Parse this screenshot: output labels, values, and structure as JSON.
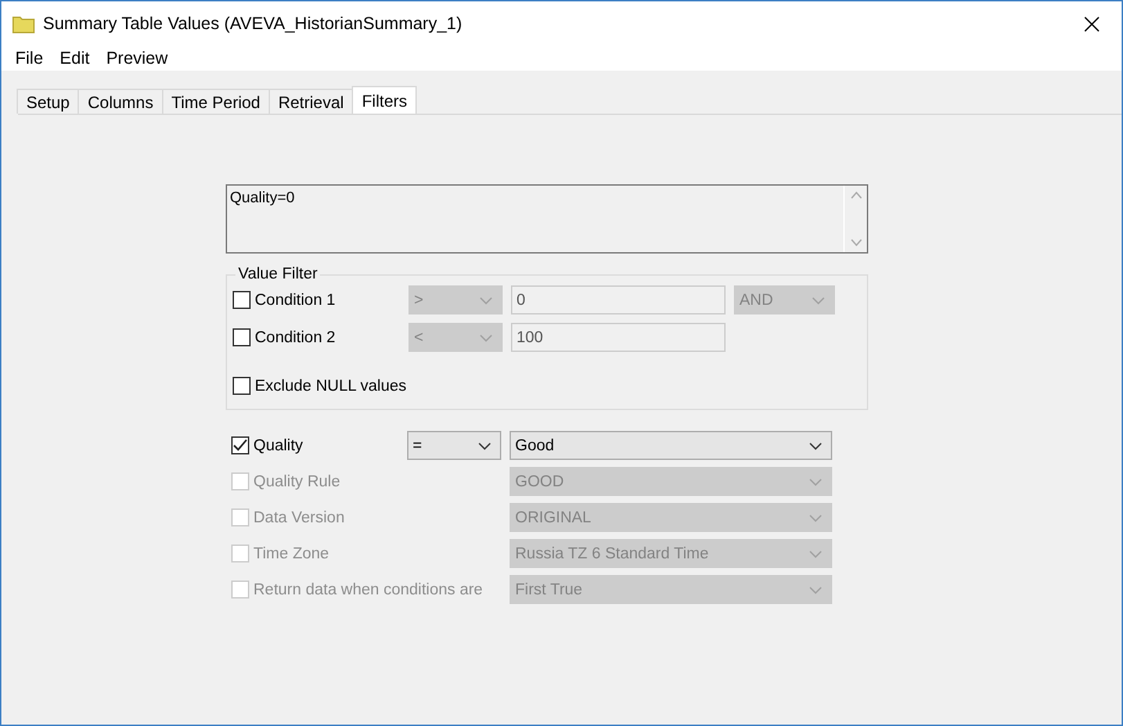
{
  "window": {
    "title": "Summary Table Values (AVEVA_HistorianSummary_1)"
  },
  "menu": [
    "File",
    "Edit",
    "Preview"
  ],
  "tabs": [
    {
      "label": "Setup",
      "selected": false
    },
    {
      "label": "Columns",
      "selected": false
    },
    {
      "label": "Time Period",
      "selected": false
    },
    {
      "label": "Retrieval",
      "selected": false
    },
    {
      "label": "Filters",
      "selected": true
    }
  ],
  "expression": "Quality=0",
  "value_filter": {
    "title": "Value Filter",
    "conditions": [
      {
        "label": "Condition 1",
        "checked": false,
        "operator": ">",
        "value": "0",
        "conjunction": "AND"
      },
      {
        "label": "Condition 2",
        "checked": false,
        "operator": "<",
        "value": "100"
      }
    ],
    "exclude_null": {
      "label": "Exclude NULL values",
      "checked": false
    }
  },
  "options": [
    {
      "label": "Quality",
      "checked": true,
      "disabled": false,
      "operator": "=",
      "value": "Good"
    },
    {
      "label": "Quality Rule",
      "checked": false,
      "disabled": true,
      "value": "GOOD"
    },
    {
      "label": "Data Version",
      "checked": false,
      "disabled": true,
      "value": "ORIGINAL"
    },
    {
      "label": "Time Zone",
      "checked": false,
      "disabled": true,
      "value": "Russia TZ 6 Standard Time"
    },
    {
      "label": "Return data when conditions are",
      "checked": false,
      "disabled": true,
      "value": "First True"
    }
  ]
}
